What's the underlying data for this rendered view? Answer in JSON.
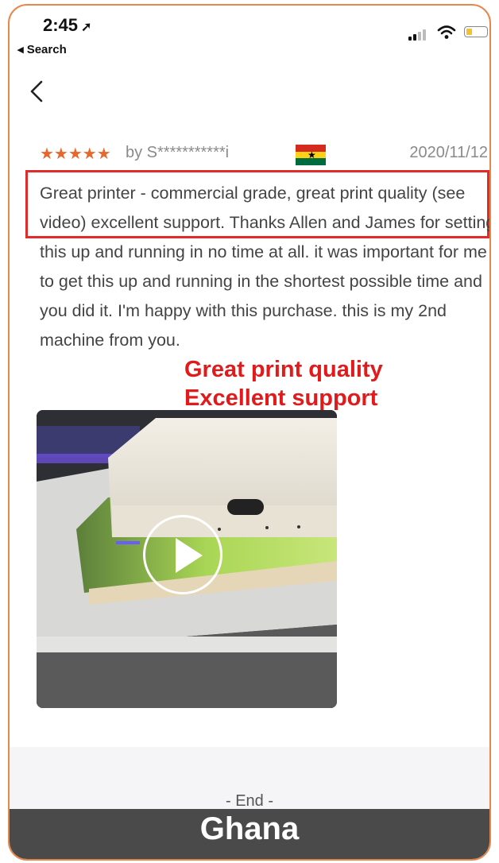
{
  "status_bar": {
    "time": "2:45",
    "location_arrow": "➚",
    "back_app_label": "◂ Search",
    "battery_color": "#f2c230"
  },
  "nav": {
    "back_icon": "chevron-left-icon"
  },
  "review": {
    "stars": "★★★★★",
    "rating_out_of_5": 5,
    "reviewer": "by S***********i",
    "flag_icon": "ghana-flag-icon",
    "date": "2020/11/12",
    "text": "Great printer - commercial grade, great print quality (see video) excellent support. Thanks Allen and James for setting this up and running in no time at all. it was important for me to get this up and running in the shortest possible time and you did it. I'm happy with this purchase. this is my 2nd machine from you.",
    "star_color": "#e8672b"
  },
  "callout": {
    "line1": "Great print quality",
    "line2": "Excellent support",
    "color": "#e11b1b"
  },
  "video": {
    "play_icon": "play-icon"
  },
  "footer": {
    "end_text": "- End -",
    "banner_text": "Ghana"
  },
  "colors": {
    "phone_border": "#e8874a",
    "highlight_border": "#e12b2b",
    "banner_bg": "#4a4a4a"
  }
}
